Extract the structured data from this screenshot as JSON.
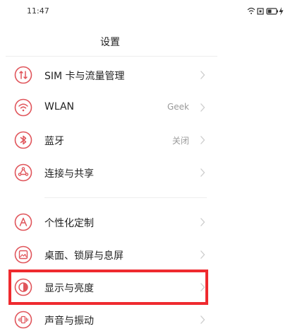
{
  "status": {
    "time": "11:47"
  },
  "header": {
    "title": "设置"
  },
  "rows": [
    {
      "label": "SIM 卡与流量管理",
      "value": ""
    },
    {
      "label": "WLAN",
      "value": "Geek"
    },
    {
      "label": "蓝牙",
      "value": "关闭"
    },
    {
      "label": "连接与共享",
      "value": ""
    },
    {
      "label": "个性化定制",
      "value": ""
    },
    {
      "label": "桌面、锁屏与息屏",
      "value": ""
    },
    {
      "label": "显示与亮度",
      "value": ""
    },
    {
      "label": "声音与振动",
      "value": ""
    }
  ],
  "colors": {
    "accent": "#e0555b",
    "highlight": "#ef2a2f",
    "chevron": "#cccccc"
  },
  "icons": [
    "sim-icon",
    "wifi-icon",
    "bluetooth-icon",
    "share-icon",
    "theme-icon",
    "wallpaper-icon",
    "display-icon",
    "sound-icon"
  ]
}
